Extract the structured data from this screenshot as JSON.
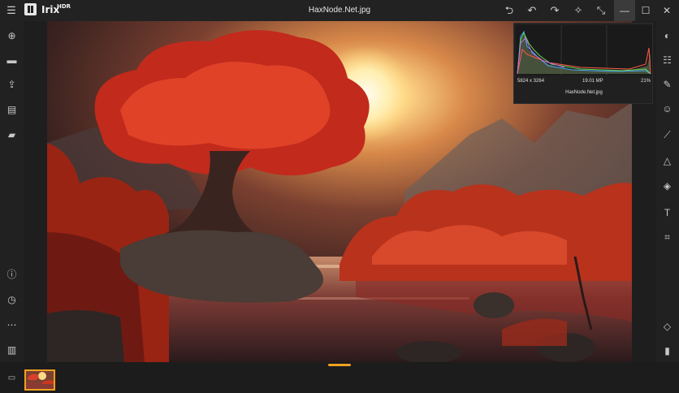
{
  "app": {
    "name": "Irix",
    "edition": "HDR"
  },
  "window": {
    "title": "HaxNode.Net.jpg"
  },
  "titlebar_icons": [
    "menu-icon",
    "app-logo-icon",
    "revert-icon",
    "undo-icon",
    "redo-icon",
    "auto-enhance-icon",
    "fullscreen-icon"
  ],
  "window_controls": {
    "minimize": "—",
    "maximize": "☐",
    "close": "✕"
  },
  "left_toolbar": [
    "add-icon",
    "open-folder-icon",
    "share-icon",
    "browser-icon",
    "panorama-icon",
    "info-icon",
    "history-icon",
    "more-icon",
    "batch-icon"
  ],
  "right_toolbar": [
    "color-palette-icon",
    "adjustments-icon",
    "brush-icon",
    "face-icon",
    "healing-brush-icon",
    "triangle-filter-icon",
    "layers-icon",
    "text-icon",
    "crop-icon",
    "compare-icon",
    "split-view-icon"
  ],
  "histogram": {
    "dimensions": "5824 x 3264",
    "megapixels": "19.01 MP",
    "zoom": "21%",
    "filename": "HaxNode.Net.jpg"
  },
  "filmstrip": {
    "icon": "filmstrip-icon",
    "thumbnail_count": 1
  },
  "colors": {
    "accent": "#f0a020",
    "background": "#1e1e1e",
    "panel": "#222222"
  }
}
